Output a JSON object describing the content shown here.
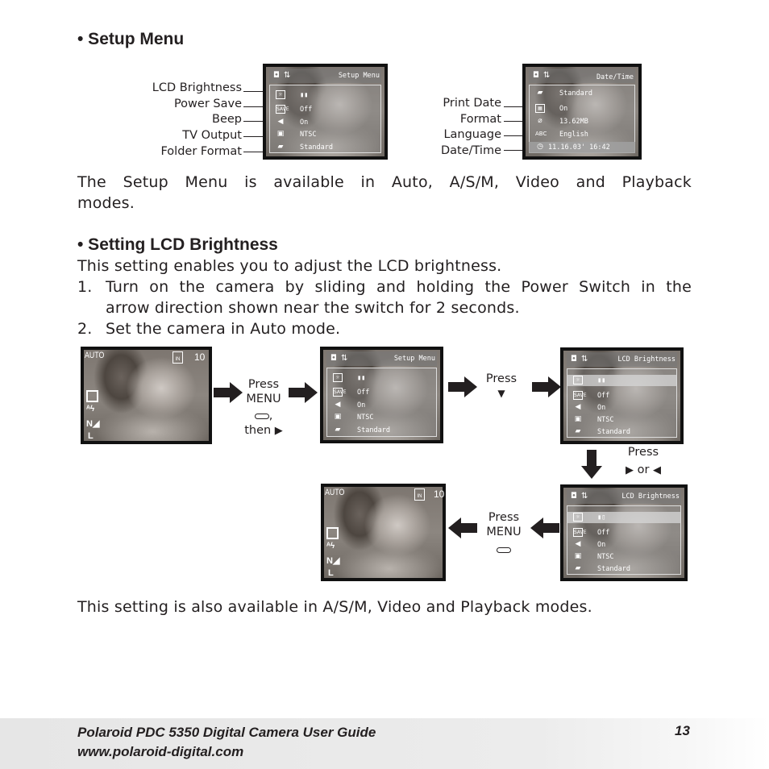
{
  "sections": {
    "setup_menu": {
      "heading": "• Setup Menu",
      "description": "The Setup Menu is available in Auto, A/S/M, Video and Playback modes.",
      "description_line1": "The Setup Menu is available in Auto, A/S/M, Video and Playback",
      "description_line2": "modes."
    },
    "lcd_brightness": {
      "heading": "• Setting LCD Brightness",
      "intro": "This setting enables you to adjust the LCD brightness.",
      "steps": [
        {
          "number": "1.",
          "line1": "Turn on the camera by sliding and holding the Power Switch in the",
          "line2": "arrow direction shown near the switch for 2 seconds."
        },
        {
          "number": "2.",
          "line1": "Set the camera in Auto mode."
        }
      ],
      "closing": "This setting is also available in A/S/M, Video and Playback modes."
    }
  },
  "diagram_setup": {
    "screen_title": "Setup Menu",
    "callouts": [
      "LCD Brightness",
      "Power Save",
      "Beep",
      "TV Output",
      "Folder Format"
    ],
    "rows": [
      {
        "icon": "lcd-brightness-icon",
        "glyph": "☼",
        "value": "▮▮"
      },
      {
        "icon": "power-save-icon",
        "glyph": "SAVE",
        "value": "Off"
      },
      {
        "icon": "beep-icon",
        "glyph": "◀ᐸ",
        "value": "On"
      },
      {
        "icon": "tv-output-icon",
        "glyph": "▣",
        "value": "NTSC"
      },
      {
        "icon": "folder-icon",
        "glyph": "▰",
        "value": "Standard"
      }
    ]
  },
  "diagram_datetime": {
    "screen_title": "Date/Time",
    "callouts": [
      "Print Date",
      "Format",
      "Language",
      "Date/Time"
    ],
    "rows": [
      {
        "icon": "folder-icon",
        "glyph": "▰",
        "value": "Standard"
      },
      {
        "icon": "print-date-icon",
        "glyph": "▦",
        "value": "On"
      },
      {
        "icon": "format-icon",
        "glyph": "⌀",
        "value": "13.62MB"
      },
      {
        "icon": "language-icon",
        "glyph": "ABC",
        "value": "English"
      },
      {
        "icon": "clock-icon",
        "glyph": "◷",
        "value": "11.16.03' 16:42"
      }
    ]
  },
  "flow": {
    "step1_label_line1": "Press",
    "step1_label_line2": "MENU",
    "step1_label_line3": ",",
    "step1_label_line4": "then",
    "step2_label": "Press",
    "step3_label_line1": "Press",
    "step3_label_line2": "or",
    "step4_label_line1": "Press",
    "step4_label_line2": "MENU",
    "live_view": {
      "mode": "AUTO",
      "memory": "IN",
      "shots": "10",
      "size": "L"
    },
    "menu_screen_title": "Setup Menu",
    "lcd_screen_title": "LCD Brightness",
    "values": [
      "Off",
      "On",
      "NTSC",
      "Standard"
    ]
  },
  "footer": {
    "title": "Polaroid PDC 5350 Digital Camera User Guide",
    "url": "www.polaroid-digital.com",
    "page_number": "13"
  }
}
